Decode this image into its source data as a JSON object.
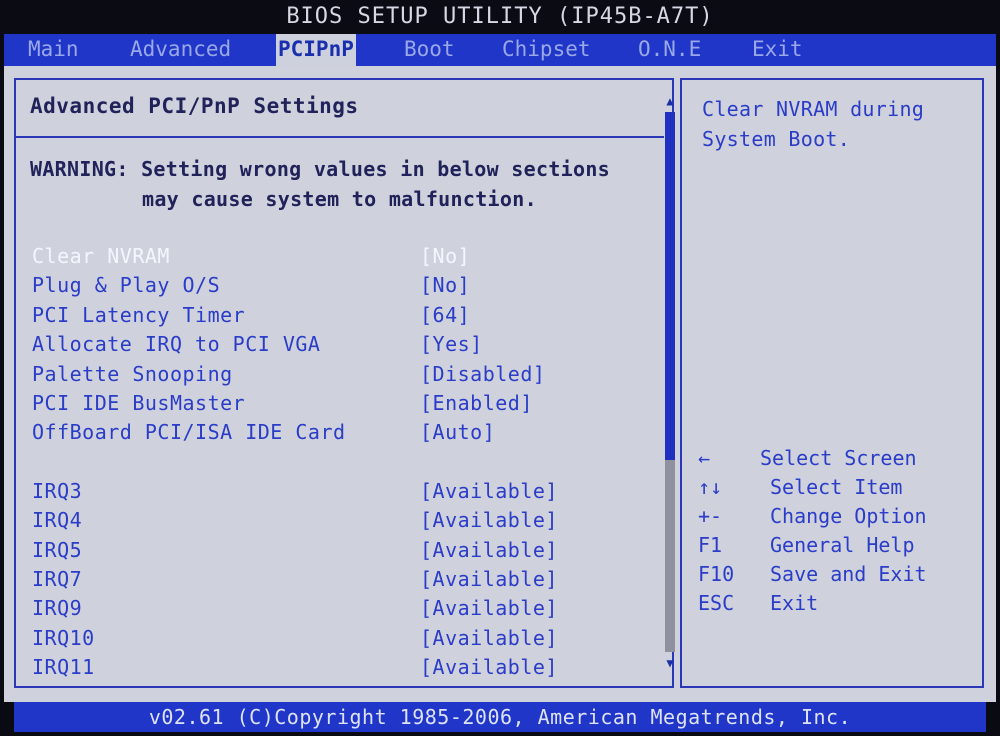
{
  "title": "BIOS SETUP UTILITY (IP45B-A7T)",
  "menu": [
    {
      "label": "Main"
    },
    {
      "label": "Advanced"
    },
    {
      "label": "PCIPnP"
    },
    {
      "label": "Boot"
    },
    {
      "label": "Chipset"
    },
    {
      "label": "O.N.E"
    },
    {
      "label": "Exit"
    }
  ],
  "active_menu": "PCIPnP",
  "panel": {
    "title": "Advanced PCI/PnP Settings",
    "warning_line1": "WARNING: Setting wrong values in below sections",
    "warning_line2": "may cause system to malfunction."
  },
  "settings": [
    {
      "label": "Clear NVRAM",
      "value": "[No]"
    },
    {
      "label": "Plug & Play O/S",
      "value": "[No]"
    },
    {
      "label": "PCI Latency Timer",
      "value": "[64]"
    },
    {
      "label": "Allocate IRQ to PCI VGA",
      "value": "[Yes]"
    },
    {
      "label": "Palette Snooping",
      "value": "[Disabled]"
    },
    {
      "label": "PCI IDE BusMaster",
      "value": "[Enabled]"
    },
    {
      "label": "OffBoard PCI/ISA IDE Card",
      "value": "[Auto]"
    }
  ],
  "irqs": [
    {
      "label": "IRQ3",
      "value": "[Available]"
    },
    {
      "label": "IRQ4",
      "value": "[Available]"
    },
    {
      "label": "IRQ5",
      "value": "[Available]"
    },
    {
      "label": "IRQ7",
      "value": "[Available]"
    },
    {
      "label": "IRQ9",
      "value": "[Available]"
    },
    {
      "label": "IRQ10",
      "value": "[Available]"
    },
    {
      "label": "IRQ11",
      "value": "[Available]"
    }
  ],
  "help": {
    "line1": "Clear NVRAM during",
    "line2": "System Boot."
  },
  "keys": [
    {
      "key": "←",
      "desc": "Select Screen"
    },
    {
      "key": "↑↓",
      "desc": "Select Item"
    },
    {
      "key": "+-",
      "desc": "Change Option"
    },
    {
      "key": "F1",
      "desc": "General Help"
    },
    {
      "key": "F10",
      "desc": "Save and Exit"
    },
    {
      "key": "ESC",
      "desc": "Exit"
    }
  ],
  "footer": "v02.61 (C)Copyright 1985-2006, American Megatrends, Inc.",
  "colors": {
    "menu_bar": "#1f36c8",
    "panel_bg": "#cfd2dc",
    "text_blue": "#2a3cc8",
    "selected_text": "#f4f6ff"
  }
}
